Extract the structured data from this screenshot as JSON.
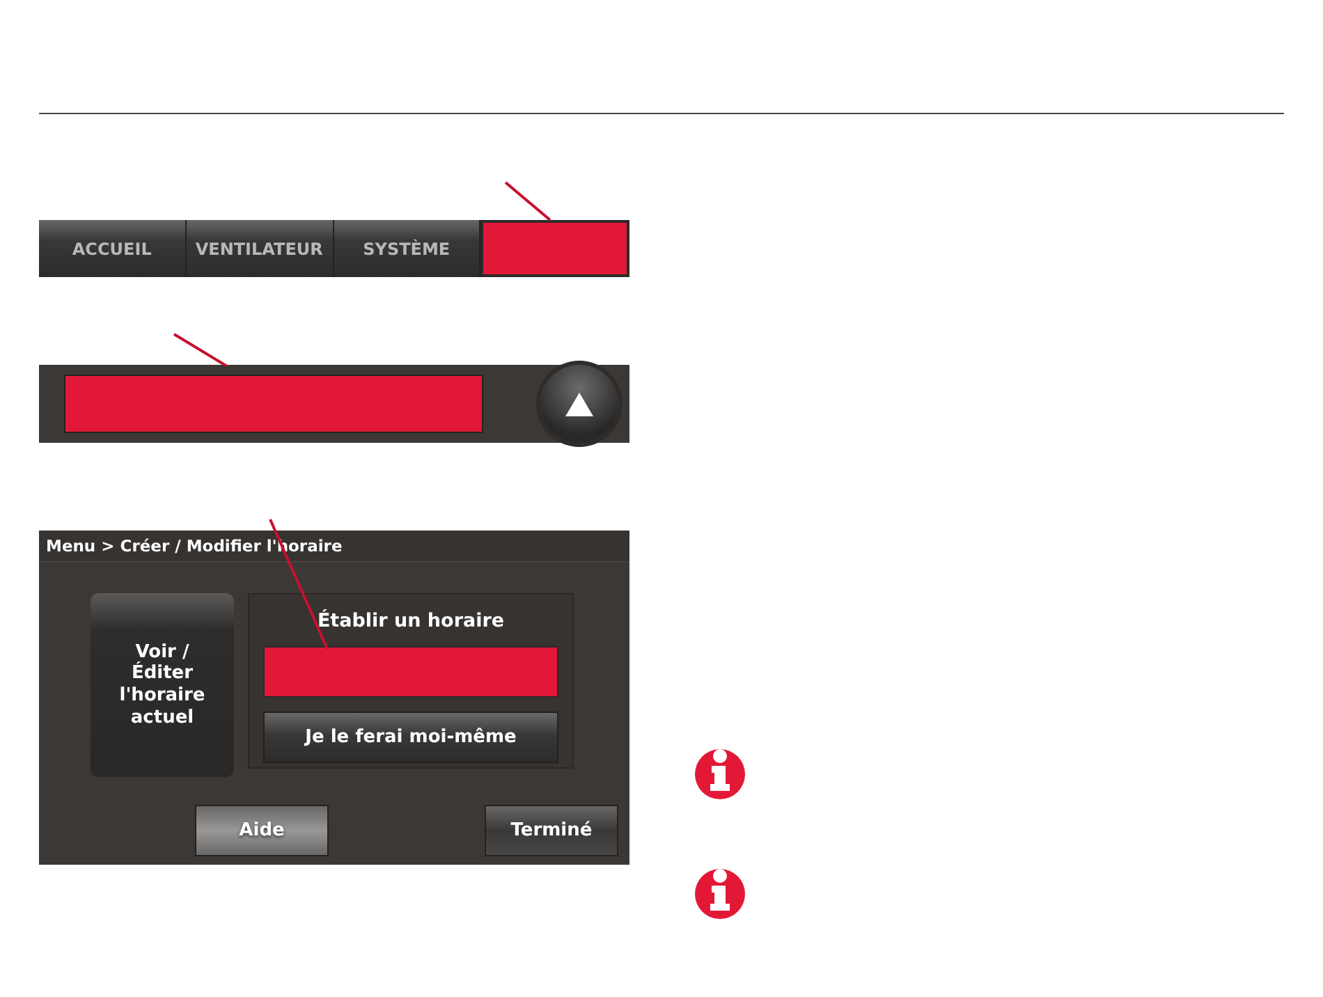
{
  "tab_bar": {
    "tabs": [
      {
        "kind": "tab",
        "label": "ACCUEIL"
      },
      {
        "kind": "tab",
        "label": "VENTILATEUR"
      },
      {
        "kind": "tab",
        "label": "SYSTÈME"
      },
      {
        "kind": "highlight"
      }
    ]
  },
  "message_bar": {
    "highlight": true
  },
  "schedule_screen": {
    "breadcrumb": "Menu > Créer / Modifier l'horaire",
    "view_button": "Voir / Éditer l'horaire actuel",
    "group_title": "Établir un horaire",
    "group_buttons": [
      {
        "kind": "highlight"
      },
      {
        "kind": "button",
        "label": "Je le ferai moi-même"
      }
    ],
    "help_button": "Aide",
    "done_button": "Terminé"
  },
  "notes": [
    {
      "kind": "info"
    },
    {
      "kind": "info"
    }
  ]
}
